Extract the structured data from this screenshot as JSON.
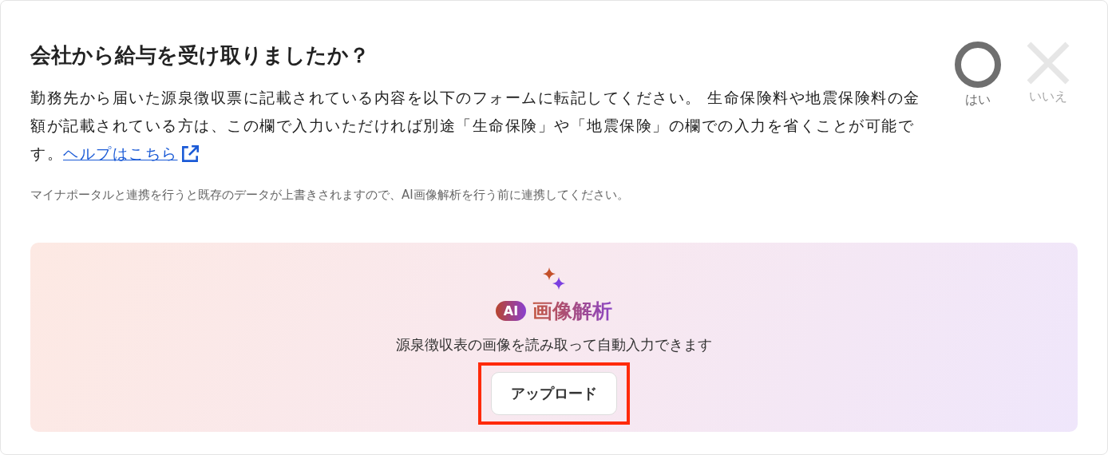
{
  "question": {
    "title": "会社から給与を受け取りましたか？",
    "description": "勤務先から届いた源泉徴収票に記載されている内容を以下のフォームに転記してください。 生命保険料や地震保険料の金額が記載されている方は、この欄で入力いただければ別途「生命保険」や「地震保険」の欄での入力を省くことが可能です。",
    "help_link": "ヘルプはこちら",
    "note": "マイナポータルと連携を行うと既存のデータが上書きされますので、AI画像解析を行う前に連携してください。"
  },
  "choices": [
    {
      "kind": "circle",
      "label": "はい",
      "selected": true
    },
    {
      "kind": "cross",
      "label": "いいえ",
      "selected": false
    }
  ],
  "ai_panel": {
    "badge": "AI",
    "title": "画像解析",
    "description": "源泉徴収表の画像を読み取って自動入力できます",
    "upload_button": {
      "label": "アップロード",
      "highlighted": true
    }
  }
}
